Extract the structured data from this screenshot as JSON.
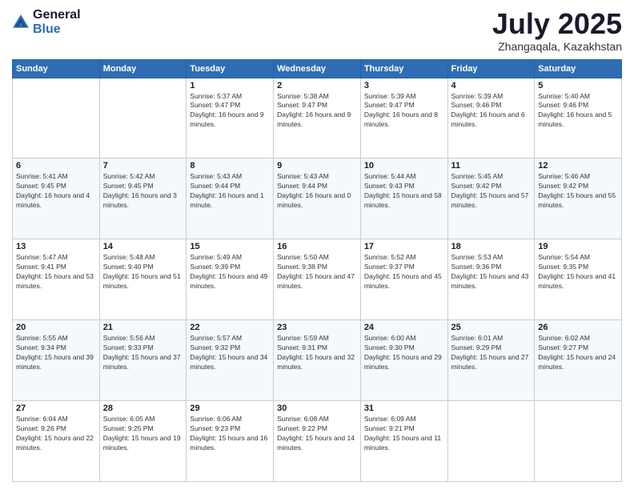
{
  "header": {
    "logo_general": "General",
    "logo_blue": "Blue",
    "month_title": "July 2025",
    "location": "Zhangaqala, Kazakhstan"
  },
  "days_of_week": [
    "Sunday",
    "Monday",
    "Tuesday",
    "Wednesday",
    "Thursday",
    "Friday",
    "Saturday"
  ],
  "weeks": [
    [
      {
        "day": "",
        "info": ""
      },
      {
        "day": "",
        "info": ""
      },
      {
        "day": "1",
        "info": "Sunrise: 5:37 AM\nSunset: 9:47 PM\nDaylight: 16 hours and 9 minutes."
      },
      {
        "day": "2",
        "info": "Sunrise: 5:38 AM\nSunset: 9:47 PM\nDaylight: 16 hours and 9 minutes."
      },
      {
        "day": "3",
        "info": "Sunrise: 5:39 AM\nSunset: 9:47 PM\nDaylight: 16 hours and 8 minutes."
      },
      {
        "day": "4",
        "info": "Sunrise: 5:39 AM\nSunset: 9:46 PM\nDaylight: 16 hours and 6 minutes."
      },
      {
        "day": "5",
        "info": "Sunrise: 5:40 AM\nSunset: 9:46 PM\nDaylight: 16 hours and 5 minutes."
      }
    ],
    [
      {
        "day": "6",
        "info": "Sunrise: 5:41 AM\nSunset: 9:45 PM\nDaylight: 16 hours and 4 minutes."
      },
      {
        "day": "7",
        "info": "Sunrise: 5:42 AM\nSunset: 9:45 PM\nDaylight: 16 hours and 3 minutes."
      },
      {
        "day": "8",
        "info": "Sunrise: 5:43 AM\nSunset: 9:44 PM\nDaylight: 16 hours and 1 minute."
      },
      {
        "day": "9",
        "info": "Sunrise: 5:43 AM\nSunset: 9:44 PM\nDaylight: 16 hours and 0 minutes."
      },
      {
        "day": "10",
        "info": "Sunrise: 5:44 AM\nSunset: 9:43 PM\nDaylight: 15 hours and 58 minutes."
      },
      {
        "day": "11",
        "info": "Sunrise: 5:45 AM\nSunset: 9:42 PM\nDaylight: 15 hours and 57 minutes."
      },
      {
        "day": "12",
        "info": "Sunrise: 5:46 AM\nSunset: 9:42 PM\nDaylight: 15 hours and 55 minutes."
      }
    ],
    [
      {
        "day": "13",
        "info": "Sunrise: 5:47 AM\nSunset: 9:41 PM\nDaylight: 15 hours and 53 minutes."
      },
      {
        "day": "14",
        "info": "Sunrise: 5:48 AM\nSunset: 9:40 PM\nDaylight: 15 hours and 51 minutes."
      },
      {
        "day": "15",
        "info": "Sunrise: 5:49 AM\nSunset: 9:39 PM\nDaylight: 15 hours and 49 minutes."
      },
      {
        "day": "16",
        "info": "Sunrise: 5:50 AM\nSunset: 9:38 PM\nDaylight: 15 hours and 47 minutes."
      },
      {
        "day": "17",
        "info": "Sunrise: 5:52 AM\nSunset: 9:37 PM\nDaylight: 15 hours and 45 minutes."
      },
      {
        "day": "18",
        "info": "Sunrise: 5:53 AM\nSunset: 9:36 PM\nDaylight: 15 hours and 43 minutes."
      },
      {
        "day": "19",
        "info": "Sunrise: 5:54 AM\nSunset: 9:35 PM\nDaylight: 15 hours and 41 minutes."
      }
    ],
    [
      {
        "day": "20",
        "info": "Sunrise: 5:55 AM\nSunset: 9:34 PM\nDaylight: 15 hours and 39 minutes."
      },
      {
        "day": "21",
        "info": "Sunrise: 5:56 AM\nSunset: 9:33 PM\nDaylight: 15 hours and 37 minutes."
      },
      {
        "day": "22",
        "info": "Sunrise: 5:57 AM\nSunset: 9:32 PM\nDaylight: 15 hours and 34 minutes."
      },
      {
        "day": "23",
        "info": "Sunrise: 5:59 AM\nSunset: 9:31 PM\nDaylight: 15 hours and 32 minutes."
      },
      {
        "day": "24",
        "info": "Sunrise: 6:00 AM\nSunset: 9:30 PM\nDaylight: 15 hours and 29 minutes."
      },
      {
        "day": "25",
        "info": "Sunrise: 6:01 AM\nSunset: 9:29 PM\nDaylight: 15 hours and 27 minutes."
      },
      {
        "day": "26",
        "info": "Sunrise: 6:02 AM\nSunset: 9:27 PM\nDaylight: 15 hours and 24 minutes."
      }
    ],
    [
      {
        "day": "27",
        "info": "Sunrise: 6:04 AM\nSunset: 9:26 PM\nDaylight: 15 hours and 22 minutes."
      },
      {
        "day": "28",
        "info": "Sunrise: 6:05 AM\nSunset: 9:25 PM\nDaylight: 15 hours and 19 minutes."
      },
      {
        "day": "29",
        "info": "Sunrise: 6:06 AM\nSunset: 9:23 PM\nDaylight: 15 hours and 16 minutes."
      },
      {
        "day": "30",
        "info": "Sunrise: 6:08 AM\nSunset: 9:22 PM\nDaylight: 15 hours and 14 minutes."
      },
      {
        "day": "31",
        "info": "Sunrise: 6:09 AM\nSunset: 9:21 PM\nDaylight: 15 hours and 11 minutes."
      },
      {
        "day": "",
        "info": ""
      },
      {
        "day": "",
        "info": ""
      }
    ]
  ]
}
